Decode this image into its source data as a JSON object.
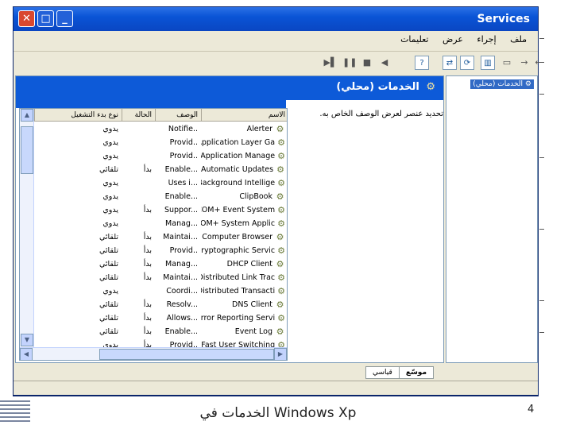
{
  "window": {
    "title": "Services",
    "controls": {
      "close": "✕",
      "maximize": "□",
      "minimize": "_"
    }
  },
  "menu": [
    "ملف",
    "إجراء",
    "عرض",
    "تعليمات"
  ],
  "tree": {
    "root": "الخدمات (محلي)"
  },
  "main": {
    "header_title": "الخدمات (محلي)",
    "description_prompt": "تحديد عنصر لعرض الوصف الخاص به.",
    "columns": {
      "name": "الاسم",
      "description": "الوصف",
      "status": "الحالة",
      "startup": "نوع بدء التشغيل"
    },
    "rows": [
      {
        "name": "Alerter",
        "description": "Notifie..",
        "status": "",
        "startup": "يدوي"
      },
      {
        "name": "Application Layer Ga..",
        "description": "Provid..",
        "status": "",
        "startup": "يدوي"
      },
      {
        "name": "Application Manage..",
        "description": "Provid..",
        "status": "",
        "startup": "يدوي"
      },
      {
        "name": "Automatic Updates",
        "description": "Enable...",
        "status": "بدأ",
        "startup": "تلقائي"
      },
      {
        "name": "Background Intellige..",
        "description": "Uses i...",
        "status": "",
        "startup": "يدوي"
      },
      {
        "name": "ClipBook",
        "description": "Enable...",
        "status": "",
        "startup": "يدوي"
      },
      {
        "name": "COM+ Event System",
        "description": "Suppor...",
        "status": "بدأ",
        "startup": "يدوي"
      },
      {
        "name": "COM+ System Applic..",
        "description": "Manag...",
        "status": "",
        "startup": "يدوي"
      },
      {
        "name": "Computer Browser",
        "description": "Maintai...",
        "status": "بدأ",
        "startup": "تلقائي"
      },
      {
        "name": "Cryptographic Servic..",
        "description": "Provid..",
        "status": "بدأ",
        "startup": "تلقائي"
      },
      {
        "name": "DHCP Client",
        "description": "Manag...",
        "status": "بدأ",
        "startup": "تلقائي"
      },
      {
        "name": "Distributed Link Trac..",
        "description": "Maintai...",
        "status": "بدأ",
        "startup": "تلقائي"
      },
      {
        "name": "Distributed Transacti..",
        "description": "Coordi...",
        "status": "",
        "startup": "يدوي"
      },
      {
        "name": "DNS Client",
        "description": "Resolv...",
        "status": "بدأ",
        "startup": "تلقائي"
      },
      {
        "name": "Error Reporting Servi..",
        "description": "Allows...",
        "status": "بدأ",
        "startup": "تلقائي"
      },
      {
        "name": "Event Log",
        "description": "Enable...",
        "status": "بدأ",
        "startup": "تلقائي"
      },
      {
        "name": "Fast User Switching..",
        "description": "Provid..",
        "status": "بدأ",
        "startup": "يدوي"
      }
    ]
  },
  "tabs": [
    "موسّع",
    "قياسي"
  ],
  "slide": {
    "caption": "الخدمات في Windows Xp",
    "page_number": "4"
  }
}
